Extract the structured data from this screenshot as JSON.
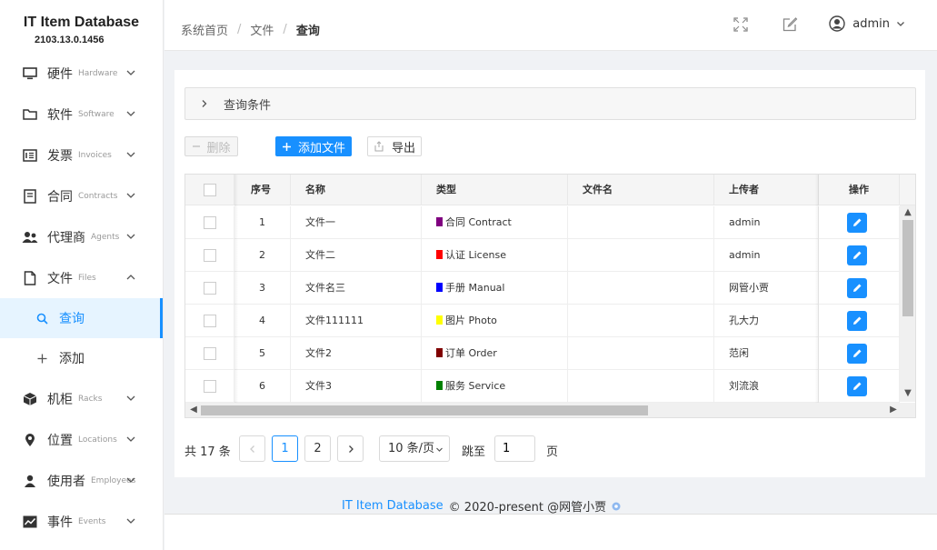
{
  "brand": {
    "title": "IT Item Database",
    "version": "2103.13.0.1456"
  },
  "sidebar": {
    "items": [
      {
        "label": "硬件",
        "sub": "Hardware"
      },
      {
        "label": "软件",
        "sub": "Software"
      },
      {
        "label": "发票",
        "sub": "Invoices"
      },
      {
        "label": "合同",
        "sub": "Contracts"
      },
      {
        "label": "代理商",
        "sub": "Agents"
      },
      {
        "label": "文件",
        "sub": "Files"
      },
      {
        "label": "机柜",
        "sub": "Racks"
      },
      {
        "label": "位置",
        "sub": "Locations"
      },
      {
        "label": "使用者",
        "sub": "Employees"
      },
      {
        "label": "事件",
        "sub": "Events"
      }
    ],
    "subitems": [
      {
        "label": "查询"
      },
      {
        "label": "添加"
      }
    ]
  },
  "header": {
    "breadcrumb": [
      "系统首页",
      "文件",
      "查询"
    ],
    "separator": "/",
    "user": "admin"
  },
  "query": {
    "label": "查询条件"
  },
  "toolbar": {
    "delete": "删除",
    "add": "添加文件",
    "export": "导出"
  },
  "table": {
    "columns": [
      "序号",
      "名称",
      "类型",
      "文件名",
      "上传者",
      "操作"
    ],
    "rows": [
      {
        "no": "1",
        "name": "文件一",
        "type": "合同 Contract",
        "type_color": "#800080",
        "file": "",
        "uploader": "admin"
      },
      {
        "no": "2",
        "name": "文件二",
        "type": "认证 License",
        "type_color": "#ff0000",
        "file": "",
        "uploader": "admin"
      },
      {
        "no": "3",
        "name": "文件名三",
        "type": "手册 Manual",
        "type_color": "#0000ff",
        "file": "",
        "uploader": "网管小贾"
      },
      {
        "no": "4",
        "name": "文件111111",
        "type": "图片 Photo",
        "type_color": "#ffff00",
        "file": "",
        "uploader": "孔大力"
      },
      {
        "no": "5",
        "name": "文件2",
        "type": "订单 Order",
        "type_color": "#800000",
        "file": "",
        "uploader": "范闲"
      },
      {
        "no": "6",
        "name": "文件3",
        "type": "服务 Service",
        "type_color": "#008000",
        "file": "",
        "uploader": "刘流浪"
      }
    ]
  },
  "pager": {
    "total": "共 17 条",
    "pages": [
      "1",
      "2"
    ],
    "current": "1",
    "page_size": "10 条/页",
    "goto": "跳至",
    "goto_value": "1",
    "page_suffix": "页"
  },
  "footer": {
    "link": "IT Item Database",
    "text": "© 2020-present @网管小贾"
  },
  "colors": {
    "accent": "#1890ff"
  }
}
